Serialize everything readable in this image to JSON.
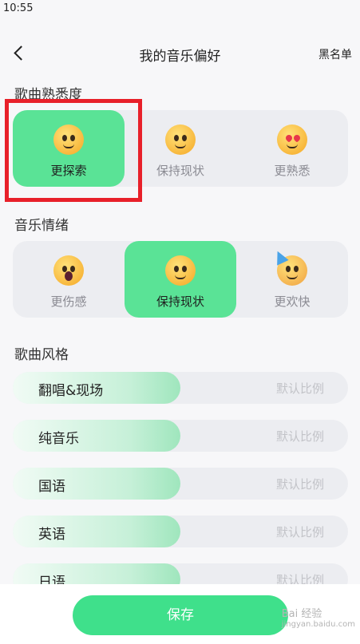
{
  "status": {
    "time": "10:55"
  },
  "nav": {
    "title": "我的音乐偏好",
    "right": "黑名单"
  },
  "familiarity": {
    "title": "歌曲熟悉度",
    "options": [
      {
        "label": "更探索",
        "icon": "monocle-face-icon",
        "selected": true
      },
      {
        "label": "保持现状",
        "icon": "smile-face-icon",
        "selected": false
      },
      {
        "label": "更熟悉",
        "icon": "heart-eyes-face-icon",
        "selected": false
      }
    ]
  },
  "mood": {
    "title": "音乐情绪",
    "options": [
      {
        "label": "更伤感",
        "icon": "crying-face-icon",
        "selected": false
      },
      {
        "label": "保持现状",
        "icon": "smile-face-icon",
        "selected": true
      },
      {
        "label": "更欢快",
        "icon": "party-face-icon",
        "selected": false
      }
    ]
  },
  "styles": {
    "title": "歌曲风格",
    "default_label": "默认比例",
    "items": [
      {
        "name": "翻唱&现场",
        "level": 0.5
      },
      {
        "name": "纯音乐",
        "level": 0.5
      },
      {
        "name": "国语",
        "level": 0.5
      },
      {
        "name": "英语",
        "level": 0.5
      },
      {
        "name": "日语",
        "level": 0.5
      }
    ]
  },
  "save_label": "保存",
  "watermark": {
    "main": "Bai 经验",
    "sub": "jingyan.baidu.com"
  },
  "colors": {
    "accent": "#5ae396",
    "save": "#3fe08b",
    "highlight_box": "#e8202a"
  }
}
